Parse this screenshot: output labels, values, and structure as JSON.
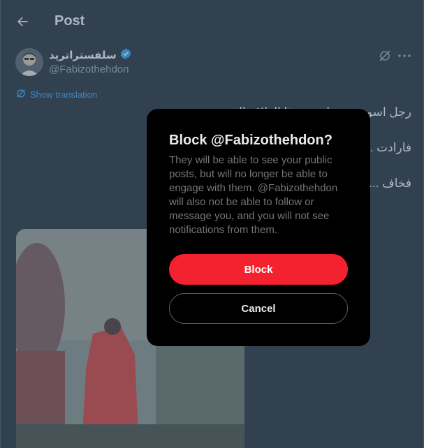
{
  "header": {
    "title": "Post",
    "back_icon": "arrow-left-icon"
  },
  "tweet": {
    "display_name": "سلفستراتريد",
    "handle": "@Fabizothehdon",
    "verified_color": "#1d9bf0",
    "show_translation": "Show translation",
    "paragraphs": [
      "رجل اسود ... وتطورت هذا العلاقة الى حب",
      "فارادت ... شي فأثار شكوكة عندها عرف انها",
      "فخاف ... ايكم هل كانت تدبر مكيدة؟"
    ]
  },
  "modal": {
    "title": "Block @Fabizothehdon?",
    "body": "They will be able to see your public posts, but will no longer be able to engage with them. @Fabizothehdon will also not be able to follow or message you, and you will not see notifications from them.",
    "block_label": "Block",
    "cancel_label": "Cancel",
    "block_color": "#f4212e"
  }
}
